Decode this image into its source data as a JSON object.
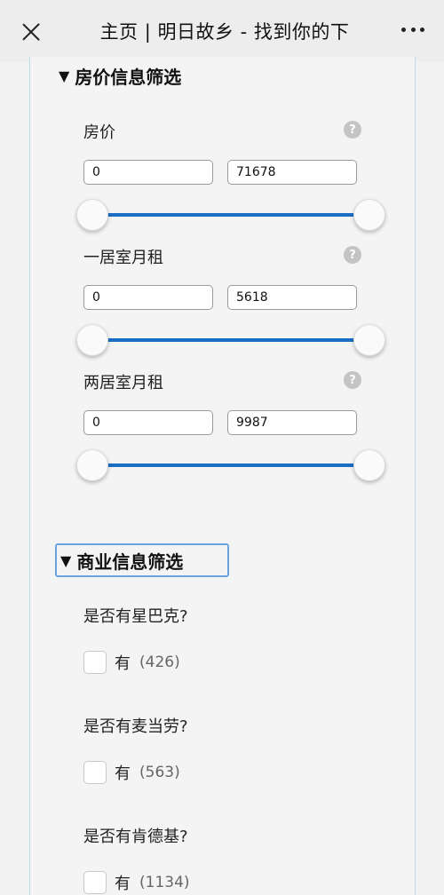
{
  "header": {
    "title": "主页 | 明日故乡 - 找到你的下"
  },
  "house_filter": {
    "heading": "房价信息筛选",
    "toggle_glyph": "▼",
    "fields": [
      {
        "label": "房价",
        "help": "?",
        "min": "0",
        "max": "71678",
        "slider_low": 0.0,
        "slider_high": 1.0
      },
      {
        "label": "一居室月租",
        "help": "?",
        "min": "0",
        "max": "5618",
        "slider_low": 0.0,
        "slider_high": 1.0
      },
      {
        "label": "两居室月租",
        "help": "?",
        "min": "0",
        "max": "9987",
        "slider_low": 0.0,
        "slider_high": 1.0
      }
    ]
  },
  "business_filter": {
    "heading": "商业信息筛选",
    "toggle_glyph": "▼",
    "questions": [
      {
        "label": "是否有星巴克?",
        "option": "有",
        "count": "(426)",
        "checked": false
      },
      {
        "label": "是否有麦当劳?",
        "option": "有",
        "count": "(563)",
        "checked": false
      },
      {
        "label": "是否有肯德基?",
        "option": "有",
        "count": "(1134)",
        "checked": false
      }
    ]
  },
  "colors": {
    "slider_track": "#1a6ec4",
    "focus_border": "#6aa3de",
    "panel_border": "#b8dde8"
  }
}
